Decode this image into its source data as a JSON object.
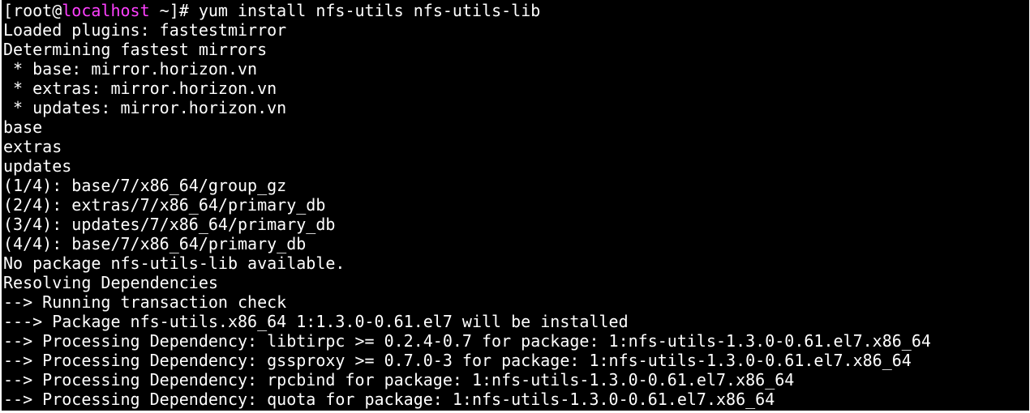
{
  "colors": {
    "background": "#000000",
    "text": "#ffffff",
    "hostname": "#ff40ff"
  },
  "terminal": {
    "prompt": {
      "open": "[root@",
      "host": "localhost",
      "rest": " ~]# ",
      "command": "yum install nfs-utils nfs-utils-lib"
    },
    "output": [
      "Loaded plugins: fastestmirror",
      "Determining fastest mirrors",
      " * base: mirror.horizon.vn",
      " * extras: mirror.horizon.vn",
      " * updates: mirror.horizon.vn",
      "base",
      "extras",
      "updates",
      "(1/4): base/7/x86_64/group_gz",
      "(2/4): extras/7/x86_64/primary_db",
      "(3/4): updates/7/x86_64/primary_db",
      "(4/4): base/7/x86_64/primary_db",
      "No package nfs-utils-lib available.",
      "Resolving Dependencies",
      "--> Running transaction check",
      "---> Package nfs-utils.x86_64 1:1.3.0-0.61.el7 will be installed",
      "--> Processing Dependency: libtirpc >= 0.2.4-0.7 for package: 1:nfs-utils-1.3.0-0.61.el7.x86_64",
      "--> Processing Dependency: gssproxy >= 0.7.0-3 for package: 1:nfs-utils-1.3.0-0.61.el7.x86_64",
      "--> Processing Dependency: rpcbind for package: 1:nfs-utils-1.3.0-0.61.el7.x86_64",
      "--> Processing Dependency: quota for package: 1:nfs-utils-1.3.0-0.61.el7.x86_64"
    ]
  }
}
